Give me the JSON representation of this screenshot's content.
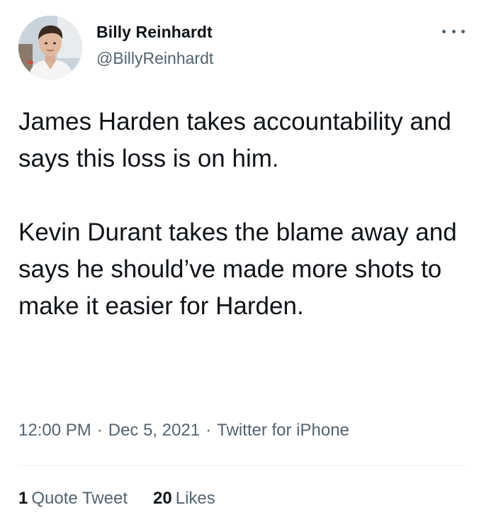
{
  "author": {
    "display_name": "Billy Reinhardt",
    "handle": "@BillyReinhardt"
  },
  "more_menu": {
    "icon": "more-horizontal-icon"
  },
  "tweet": {
    "paragraphs": [
      "James Harden takes accountability and says this loss is on him.",
      "Kevin Durant takes the blame away and says he should’ve made more shots to make it easier for Harden."
    ]
  },
  "meta": {
    "time": "12:00 PM",
    "separator": "·",
    "date": "Dec 5, 2021",
    "source": "Twitter for iPhone"
  },
  "stats": {
    "quote_tweets_count": "1",
    "quote_tweets_label": "Quote Tweet",
    "likes_count": "20",
    "likes_label": "Likes"
  },
  "colors": {
    "text_primary": "#0f1419",
    "text_secondary": "#536471",
    "divider": "#eff3f4",
    "background": "#ffffff"
  }
}
